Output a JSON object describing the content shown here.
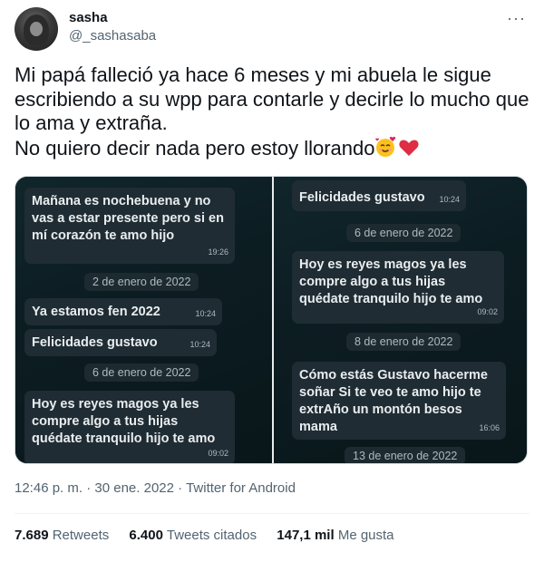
{
  "user": {
    "name": "sasha",
    "handle": "@_sashasaba",
    "more_icon": "···"
  },
  "tweet": {
    "text": "Mi papá falleció ya hace 6 meses y mi abuela le sigue escribiendo a su wpp para contarle y decirle lo mucho que lo ama y extraña.\nNo quiero decir nada pero estoy llorando",
    "emojis": [
      "smiling-face-with-hearts",
      "red-heart"
    ]
  },
  "media": {
    "left": {
      "bubbles": [
        {
          "text": "Mañana es nochebuena y no vas a estar presente pero si en mí corazón te amo hijo",
          "time": "19:26"
        },
        {
          "text": "Ya estamos fen 2022",
          "time": "10:24"
        },
        {
          "text": "Felicidades gustavo",
          "time": "10:24"
        },
        {
          "text": "Hoy es reyes magos ya les compre algo a tus hijas quédate tranquilo hijo te amo",
          "time": "09:02"
        }
      ],
      "dates": [
        "2 de enero de 2022",
        "6 de enero de 2022"
      ]
    },
    "right": {
      "bubbles": [
        {
          "text": "Felicidades gustavo",
          "time": "10:24"
        },
        {
          "text": "Hoy es reyes magos ya les compre algo a tus hijas quédate tranquilo hijo te amo",
          "time": "09:02"
        },
        {
          "text": "Cómo estás Gustavo hacerme soñar Si te veo te amo hijo te extrAño un montón besos mama",
          "time": "16:06"
        }
      ],
      "dates": [
        "6 de enero de 2022",
        "8 de enero de 2022",
        "13 de enero de 2022"
      ]
    }
  },
  "meta": {
    "time": "12:46 p. m.",
    "date": "30 ene. 2022",
    "source": "Twitter for Android",
    "dot": "·"
  },
  "stats": {
    "retweets": {
      "value": "7.689",
      "label": "Retweets"
    },
    "quotes": {
      "value": "6.400",
      "label": "Tweets citados"
    },
    "likes": {
      "value": "147,1 mil",
      "label": "Me gusta"
    }
  }
}
